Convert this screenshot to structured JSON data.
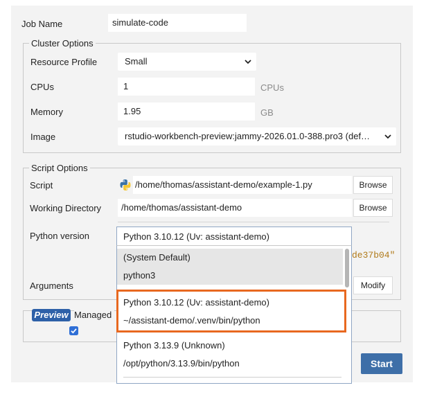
{
  "form": {
    "job_name": {
      "label": "Job Name",
      "value": "simulate-code"
    },
    "cluster_options": {
      "legend": "Cluster Options",
      "resource_profile": {
        "label": "Resource Profile",
        "value": "Small"
      },
      "cpus": {
        "label": "CPUs",
        "value": "1",
        "unit": "CPUs"
      },
      "memory": {
        "label": "Memory",
        "value": "1.95",
        "unit": "GB"
      },
      "image": {
        "label": "Image",
        "value": "rstudio-workbench-preview:jammy-2026.01.0-388.pro3 (def…"
      }
    },
    "script_options": {
      "legend": "Script Options",
      "script": {
        "label": "Script",
        "value": "/home/thomas/assistant-demo/example-1.py",
        "button": "Browse"
      },
      "working_directory": {
        "label": "Working Directory",
        "value": "/home/thomas/assistant-demo",
        "button": "Browse"
      },
      "python_version": {
        "label": "Python version",
        "value": "Python 3.10.12 (Uv: assistant-demo)"
      },
      "hash_fragment": "de37b04\"",
      "arguments": {
        "label": "Arguments",
        "button": "Modify"
      }
    },
    "preview": {
      "badge": "Preview",
      "label": "Managed",
      "checked": true
    },
    "start_label": "Start"
  },
  "dropdown": {
    "options": [
      {
        "name": "(System Default)",
        "path": "python3",
        "state": "hover"
      },
      {
        "name": "Python 3.10.12 (Uv: assistant-demo)",
        "path": "~/assistant-demo/.venv/bin/python",
        "state": "highlighted"
      },
      {
        "name": "Python 3.13.9 (Unknown)",
        "path": "/opt/python/3.13.9/bin/python",
        "state": "normal"
      }
    ]
  },
  "colors": {
    "accent": "#3e6fa8",
    "highlight": "#e8681f",
    "hash_text": "#b07a1a",
    "preview_badge": "#2d60a8"
  },
  "icons": [
    "python-icon",
    "chevron-down-icon",
    "checkbox-checked-icon"
  ]
}
